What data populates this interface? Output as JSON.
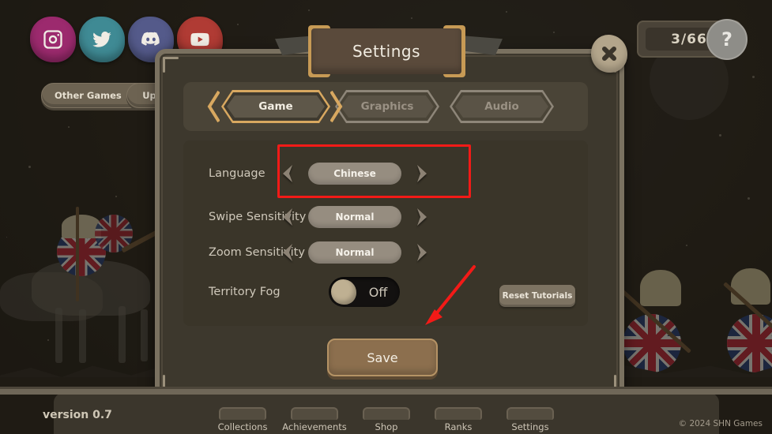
{
  "window": {
    "title": "Settings",
    "version_label": "version 0.7",
    "copyright": "© 2024 SHN Games"
  },
  "topbar": {
    "social_buttons": [
      {
        "name": "instagram",
        "label": "Instagram",
        "color": "#9c2a6e"
      },
      {
        "name": "twitter",
        "label": "Twitter",
        "color": "#3f8a94"
      },
      {
        "name": "discord",
        "label": "Discord",
        "color": "#545a8a"
      },
      {
        "name": "youtube",
        "label": "YouTube",
        "color": "#b03b34"
      }
    ],
    "other_games_label": "Other Games",
    "other_games_icon": "external-link-arrow",
    "update_label": "Upda",
    "counter_value": "3/66",
    "counter_badge_icon": "question-mark-icon"
  },
  "modal": {
    "title": "Settings",
    "close_icon": "close-x-icon",
    "tabs": [
      {
        "label": "Game",
        "active": true
      },
      {
        "label": "Graphics",
        "active": false
      },
      {
        "label": "Audio",
        "active": false
      }
    ],
    "rows": [
      {
        "label": "Language",
        "type": "stepper",
        "value": "Chinese",
        "left_icon": "chevron-left-icon",
        "right_icon": "chevron-right-icon",
        "highlighted": true
      },
      {
        "label": "Swipe Sensitivity",
        "type": "stepper",
        "value": "Normal",
        "left_icon": "chevron-left-icon",
        "right_icon": "chevron-right-icon",
        "highlighted": false
      },
      {
        "label": "Zoom Sensitivity",
        "type": "stepper",
        "value": "Normal",
        "left_icon": "chevron-left-icon",
        "right_icon": "chevron-right-icon",
        "highlighted": false
      },
      {
        "label": "Territory Fog",
        "type": "toggle",
        "value": "Off",
        "highlighted": false
      }
    ],
    "reset_tutorials_label": "Reset Tutorials",
    "save_label": "Save"
  },
  "bottom_nav": {
    "items": [
      {
        "label": "Collections"
      },
      {
        "label": "Achievements"
      },
      {
        "label": "Shop"
      },
      {
        "label": "Ranks"
      },
      {
        "label": "Settings"
      }
    ]
  },
  "annotations": {
    "highlight_color": "#f31a17",
    "highlight_target": "Language",
    "arrow_color": "#f31a17",
    "arrow_points_to": "save-button"
  },
  "colors": {
    "panel_bg": "#3d382d",
    "panel_border": "#7a7160",
    "accent_gold": "#d8a860",
    "text_primary": "#f1ece1",
    "text_secondary": "#9a9184",
    "save_button": "#8c6f4e"
  }
}
